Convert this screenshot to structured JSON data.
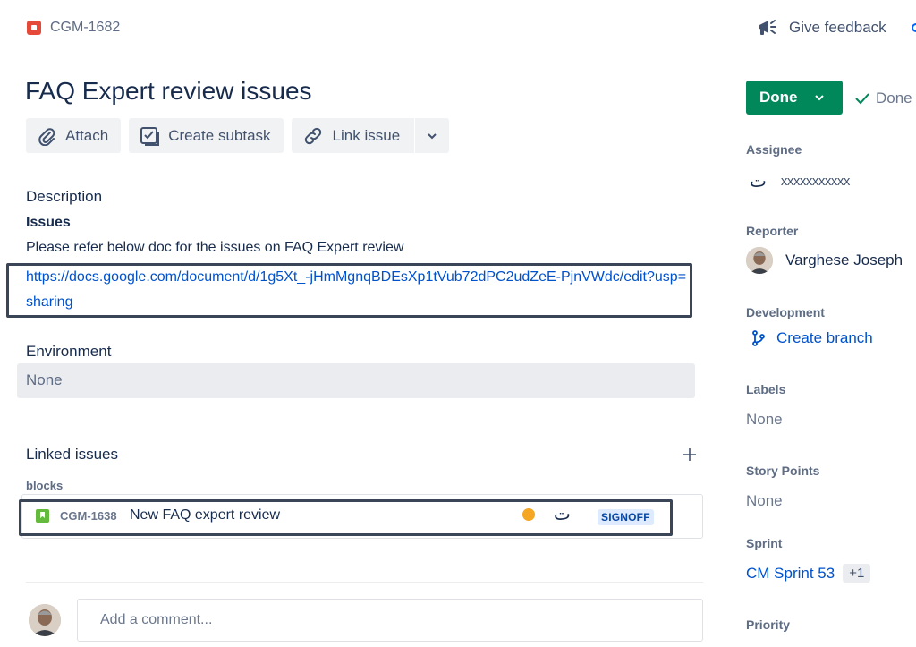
{
  "header": {
    "issue_key": "CGM-1682",
    "feedback_label": "Give feedback",
    "title": "FAQ Expert review issues"
  },
  "toolbar": {
    "attach_label": "Attach",
    "subtask_label": "Create subtask",
    "link_label": "Link issue"
  },
  "description": {
    "label": "Description",
    "heading": "Issues",
    "text": "Please refer below doc for the issues on FAQ Expert review",
    "link": "https://docs.google.com/document/d/1g5Xt_-jHmMgnqBDEsXp1tVub72dPC2udZeE-PjnVWdc/edit?usp=sharing"
  },
  "environment": {
    "label": "Environment",
    "value": "None"
  },
  "linked_issues": {
    "label": "Linked issues",
    "relation": "blocks",
    "items": [
      {
        "key": "CGM-1638",
        "summary": "New FAQ expert review",
        "assignee_glyph": "ت",
        "status": "SIGNOFF"
      }
    ]
  },
  "comment": {
    "placeholder": "Add a comment..."
  },
  "sidebar": {
    "status_button": "Done",
    "resolution": "Done",
    "assignee_label": "Assignee",
    "assignee_glyph": "ت",
    "assignee_name": "xxxxxxxxxxx",
    "reporter_label": "Reporter",
    "reporter_name": "Varghese Joseph",
    "development_label": "Development",
    "create_branch": "Create branch",
    "labels_label": "Labels",
    "labels_value": "None",
    "story_points_label": "Story Points",
    "story_points_value": "None",
    "sprint_label": "Sprint",
    "sprint_value": "CM Sprint 53",
    "sprint_more": "+1",
    "priority_label": "Priority"
  },
  "colors": {
    "accent": "#0052cc",
    "done_green": "#00875a",
    "bug_red": "#e5493a",
    "story_green": "#63ba3c",
    "priority_orange": "#f5a623",
    "highlight_border": "#3a4557"
  },
  "icons": [
    "bug-icon",
    "megaphone-icon",
    "paperclip-icon",
    "subtask-icon",
    "link-icon",
    "chevron-down-icon",
    "plus-icon",
    "story-icon",
    "priority-icon",
    "check-icon",
    "branch-icon"
  ]
}
